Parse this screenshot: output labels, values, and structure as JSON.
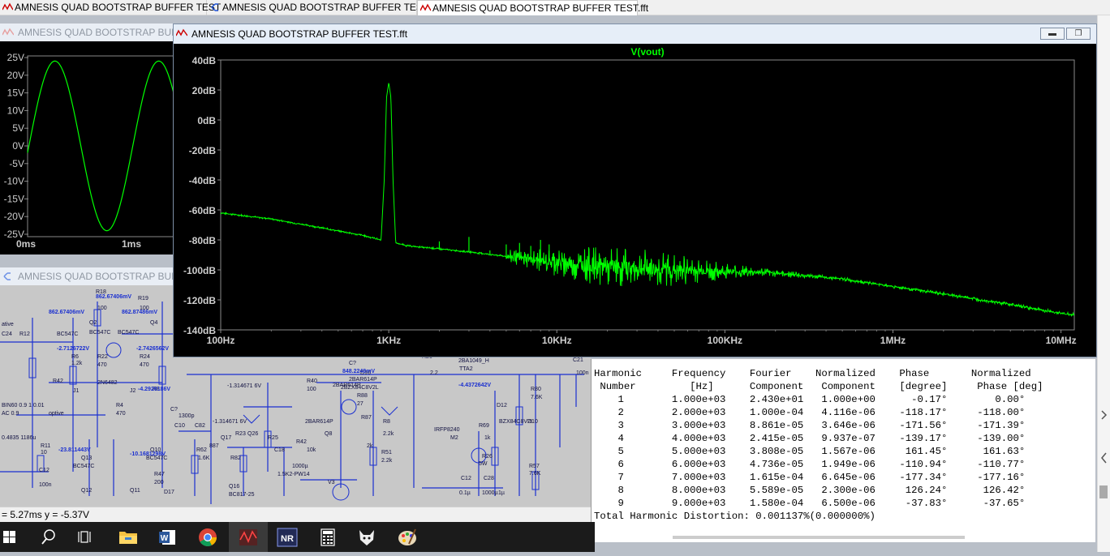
{
  "tabs": [
    {
      "label": "AMNESIS QUAD BOOTSTRAP BUFFER TEST"
    },
    {
      "label": "AMNESIS QUAD BOOTSTRAP BUFFER TEST"
    },
    {
      "label": "AMNESIS QUAD BOOTSTRAP BUFFER TEST.fft"
    }
  ],
  "wave_window": {
    "title": "AMNESIS QUAD BOOTSTRAP BUFFER TEST",
    "y_ticks": [
      "25V",
      "20V",
      "15V",
      "10V",
      "5V",
      "0V",
      "-5V",
      "-10V",
      "-15V",
      "-20V",
      "-25V"
    ],
    "x_ticks": [
      "0ms",
      "1ms"
    ]
  },
  "schematic_window": {
    "title": "AMNESIS QUAD BOOTSTRAP BUFFER TEST"
  },
  "fft_window": {
    "title": "AMNESIS QUAD BOOTSTRAP BUFFER TEST.fft",
    "minimize": "▬",
    "restore": "❐"
  },
  "chart_data": {
    "type": "line",
    "title": "V(vout)",
    "xlabel": "",
    "ylabel": "",
    "x_scale": "log",
    "xlim": [
      100,
      12000000
    ],
    "ylim": [
      -140,
      40
    ],
    "y_ticks": [
      "40dB",
      "20dB",
      "0dB",
      "-20dB",
      "-40dB",
      "-60dB",
      "-80dB",
      "-100dB",
      "-120dB",
      "-140dB"
    ],
    "x_ticks": [
      "100Hz",
      "1KHz",
      "10KHz",
      "100KHz",
      "1MHz",
      "10MHz"
    ],
    "series": [
      {
        "name": "V(vout)",
        "color": "#00ff00",
        "x": [
          100,
          200,
          400,
          700,
          900,
          940,
          970,
          1000,
          1030,
          1060,
          1100,
          1300,
          2000,
          3000,
          5000,
          10000,
          20000,
          50000,
          100000,
          200000,
          500000,
          1000000,
          2000000,
          5000000,
          10000000,
          12000000
        ],
        "y": [
          -62,
          -66,
          -72,
          -77,
          -80,
          -40,
          15,
          25,
          15,
          -40,
          -82,
          -84,
          -86,
          -88,
          -91,
          -95,
          -98,
          -100,
          -101,
          -102,
          -106,
          -111,
          -116,
          -123,
          -129,
          -130
        ]
      }
    ],
    "spurs": [
      {
        "x": 2000,
        "y": -81
      },
      {
        "x": 3000,
        "y": -78
      },
      {
        "x": 4000,
        "y": -87
      },
      {
        "x": 5000,
        "y": -83
      },
      {
        "x": 6000,
        "y": -82
      },
      {
        "x": 7000,
        "y": -84
      },
      {
        "x": 8000,
        "y": -80
      },
      {
        "x": 9000,
        "y": -83
      },
      {
        "x": 2000000,
        "y": -117
      }
    ],
    "grid": false,
    "legend": "top-center"
  },
  "harmonics": {
    "header1": "Harmonic     Frequency    Fourier    Normalized    Phase       Normalized",
    "header2": " Number         [Hz]      Component   Component    [degree]     Phase [deg]",
    "rows": [
      "    1        1.000e+03    2.430e+01   1.000e+00      -0.17°        0.00°",
      "    2        2.000e+03    1.000e-04   4.116e-06    -118.17°     -118.00°",
      "    3        3.000e+03    8.861e-05   3.646e-06    -171.56°     -171.39°",
      "    4        4.000e+03    2.415e-05   9.937e-07    -139.17°     -139.00°",
      "    5        5.000e+03    3.808e-05   1.567e-06     161.45°      161.63°",
      "    6        6.000e+03    4.736e-05   1.949e-06    -110.94°     -110.77°",
      "    7        7.000e+03    1.615e-04   6.645e-06    -177.34°     -177.16°",
      "    8        8.000e+03    5.589e-05   2.300e-06     126.24°      126.42°",
      "    9        9.000e+03    1.580e-04   6.500e-06     -37.83°      -37.65°"
    ],
    "total": "Total Harmonic Distortion: 0.001137%(0.000000%)"
  },
  "status": {
    "text": "= 5.27ms   y = -5.37V"
  },
  "taskbar": {
    "items": [
      "windows-start",
      "search",
      "task-view",
      "file-explorer",
      "word",
      "chrome",
      "ltspice",
      "nr-app",
      "calculator",
      "fox-app",
      "paint"
    ]
  }
}
